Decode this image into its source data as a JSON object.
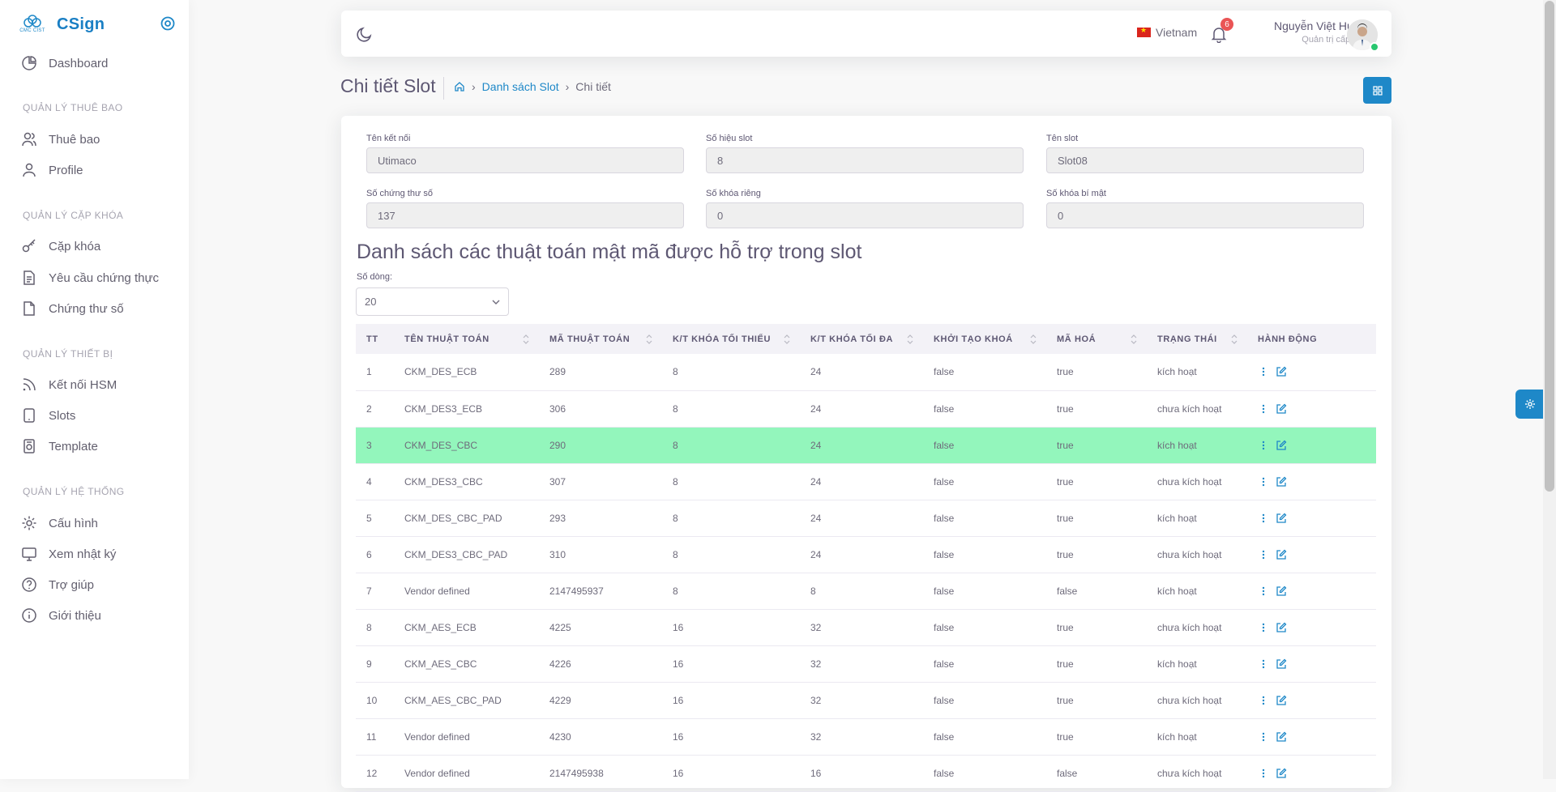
{
  "brand": {
    "logo_text": "CMC CIST",
    "name": "CSign"
  },
  "sidebar": {
    "dashboard": "Dashboard",
    "sections": [
      {
        "header": "QUẢN LÝ THUÊ BAO",
        "items": [
          "Thuê bao",
          "Profile"
        ]
      },
      {
        "header": "QUẢN LÝ CẶP KHÓA",
        "items": [
          "Cặp khóa",
          "Yêu cầu chứng thực",
          "Chứng thư số"
        ]
      },
      {
        "header": "QUẢN LÝ THIẾT BỊ",
        "items": [
          "Kết nối HSM",
          "Slots",
          "Template"
        ]
      },
      {
        "header": "QUẢN LÝ HỆ THỐNG",
        "items": [
          "Cấu hình",
          "Xem nhật ký",
          "Trợ giúp",
          "Giới thiệu"
        ]
      }
    ]
  },
  "navbar": {
    "language": "Vietnam",
    "notification_count": "6",
    "user_name": "Nguyễn Việt Hưng",
    "user_role": "Quản trị cấp cao"
  },
  "page": {
    "title": "Chi tiết Slot",
    "breadcrumb": {
      "list": "Danh sách Slot",
      "current": "Chi tiết"
    }
  },
  "details": {
    "connection_name": {
      "label": "Tên kết nối",
      "value": "Utimaco"
    },
    "slot_number": {
      "label": "Số hiệu slot",
      "value": "8"
    },
    "slot_name": {
      "label": "Tên slot",
      "value": "Slot08"
    },
    "cert_count": {
      "label": "Số chứng thư số",
      "value": "137"
    },
    "private_key_count": {
      "label": "Số khóa riêng",
      "value": "0"
    },
    "secret_key_count": {
      "label": "Số khóa bí mật",
      "value": "0"
    }
  },
  "algorithms": {
    "title": "Danh sách các thuật toán mật mã được hỗ trợ trong slot",
    "rows_label": "Số dòng:",
    "rows_value": "20",
    "columns": [
      "TT",
      "TÊN THUẬT TOÁN",
      "MÃ THUẬT TOÁN",
      "K/T KHÓA TỐI THIỂU",
      "K/T KHÓA TỐI ĐA",
      "KHỞI TẠO KHOÁ",
      "MÃ HOÁ",
      "TRẠNG THÁI",
      "HÀNH ĐỘNG"
    ],
    "rows": [
      [
        "1",
        "CKM_DES_ECB",
        "289",
        "8",
        "24",
        "false",
        "true",
        "kích hoạt"
      ],
      [
        "2",
        "CKM_DES3_ECB",
        "306",
        "8",
        "24",
        "false",
        "true",
        "chưa kích hoạt"
      ],
      [
        "3",
        "CKM_DES_CBC",
        "290",
        "8",
        "24",
        "false",
        "true",
        "kích hoạt"
      ],
      [
        "4",
        "CKM_DES3_CBC",
        "307",
        "8",
        "24",
        "false",
        "true",
        "chưa kích hoạt"
      ],
      [
        "5",
        "CKM_DES_CBC_PAD",
        "293",
        "8",
        "24",
        "false",
        "true",
        "kích hoạt"
      ],
      [
        "6",
        "CKM_DES3_CBC_PAD",
        "310",
        "8",
        "24",
        "false",
        "true",
        "chưa kích hoạt"
      ],
      [
        "7",
        "Vendor defined",
        "2147495937",
        "8",
        "8",
        "false",
        "false",
        "kích hoạt"
      ],
      [
        "8",
        "CKM_AES_ECB",
        "4225",
        "16",
        "32",
        "false",
        "true",
        "chưa kích hoạt"
      ],
      [
        "9",
        "CKM_AES_CBC",
        "4226",
        "16",
        "32",
        "false",
        "true",
        "kích hoạt"
      ],
      [
        "10",
        "CKM_AES_CBC_PAD",
        "4229",
        "16",
        "32",
        "false",
        "true",
        "chưa kích hoạt"
      ],
      [
        "11",
        "Vendor defined",
        "4230",
        "16",
        "32",
        "false",
        "true",
        "kích hoạt"
      ],
      [
        "12",
        "Vendor defined",
        "2147495938",
        "16",
        "16",
        "false",
        "false",
        "chưa kích hoạt"
      ]
    ],
    "highlighted_row": 3
  },
  "colors": {
    "primary": "#1e88c8",
    "highlight": "#93f6bc",
    "danger": "#ea5455"
  }
}
